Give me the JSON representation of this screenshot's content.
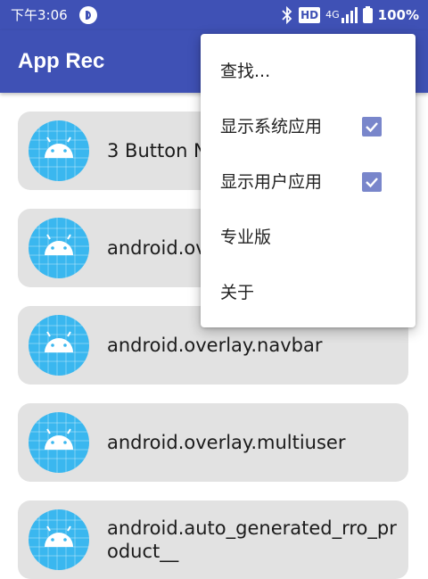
{
  "status_bar": {
    "time": "下午3:06",
    "hd_label": "HD",
    "network_label": "4G",
    "battery_text": "100%",
    "icons": [
      "app-notification-icon",
      "bluetooth-icon",
      "signal-icon",
      "battery-icon"
    ]
  },
  "app_bar": {
    "title": "App Rec"
  },
  "apps": [
    {
      "name": "3 Button N"
    },
    {
      "name": "android.ov"
    },
    {
      "name": "android.overlay.navbar"
    },
    {
      "name": "android.overlay.multiuser"
    },
    {
      "name": "android.auto_generated_rro_product__"
    }
  ],
  "menu": {
    "items": [
      {
        "label": "查找...",
        "checkbox": false
      },
      {
        "label": "显示系统应用",
        "checkbox": true,
        "checked": true
      },
      {
        "label": "显示用户应用",
        "checkbox": true,
        "checked": true
      },
      {
        "label": "专业版",
        "checkbox": false
      },
      {
        "label": "关于",
        "checkbox": false
      }
    ]
  },
  "colors": {
    "primary": "#3f51b5",
    "card_bg": "#e2e2e2",
    "app_icon_bg": "#3ab7ef",
    "android_green": "#ffffff",
    "checkbox": "#7986cb"
  }
}
